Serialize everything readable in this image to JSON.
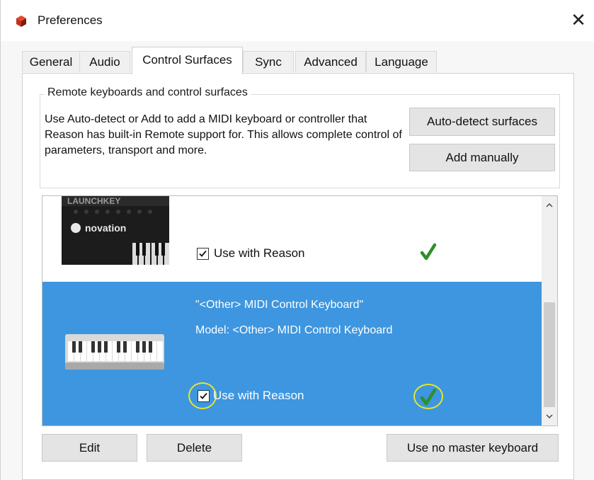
{
  "window": {
    "title": "Preferences",
    "close_glyph": "✕"
  },
  "tabs": [
    {
      "label": "General"
    },
    {
      "label": "Audio"
    },
    {
      "label": "Control Surfaces",
      "active": true
    },
    {
      "label": "Sync"
    },
    {
      "label": "Advanced"
    },
    {
      "label": "Language"
    }
  ],
  "group": {
    "title": "Remote keyboards and control surfaces",
    "description": "Use Auto-detect or Add to add a MIDI keyboard or controller that Reason has built-in Remote support for. This allows complete control of parameters, transport and more.",
    "auto_detect_label": "Auto-detect surfaces",
    "add_manually_label": "Add manually"
  },
  "surfaces": [
    {
      "brand_text": "novation",
      "use_label": "Use with Reason",
      "checked": true,
      "status_icon": "green-check-icon"
    },
    {
      "name": "\"<Other> MIDI Control Keyboard\"",
      "model": "Model: <Other> MIDI Control Keyboard",
      "use_label": "Use with Reason",
      "checked": true,
      "status_icon": "green-check-icon",
      "selected": true
    }
  ],
  "buttons": {
    "edit": "Edit",
    "delete": "Delete",
    "no_master": "Use no master keyboard"
  },
  "colors": {
    "selection": "#3d96df",
    "check_green": "#2f8f2a",
    "highlight_circle": "#e6e62a"
  }
}
